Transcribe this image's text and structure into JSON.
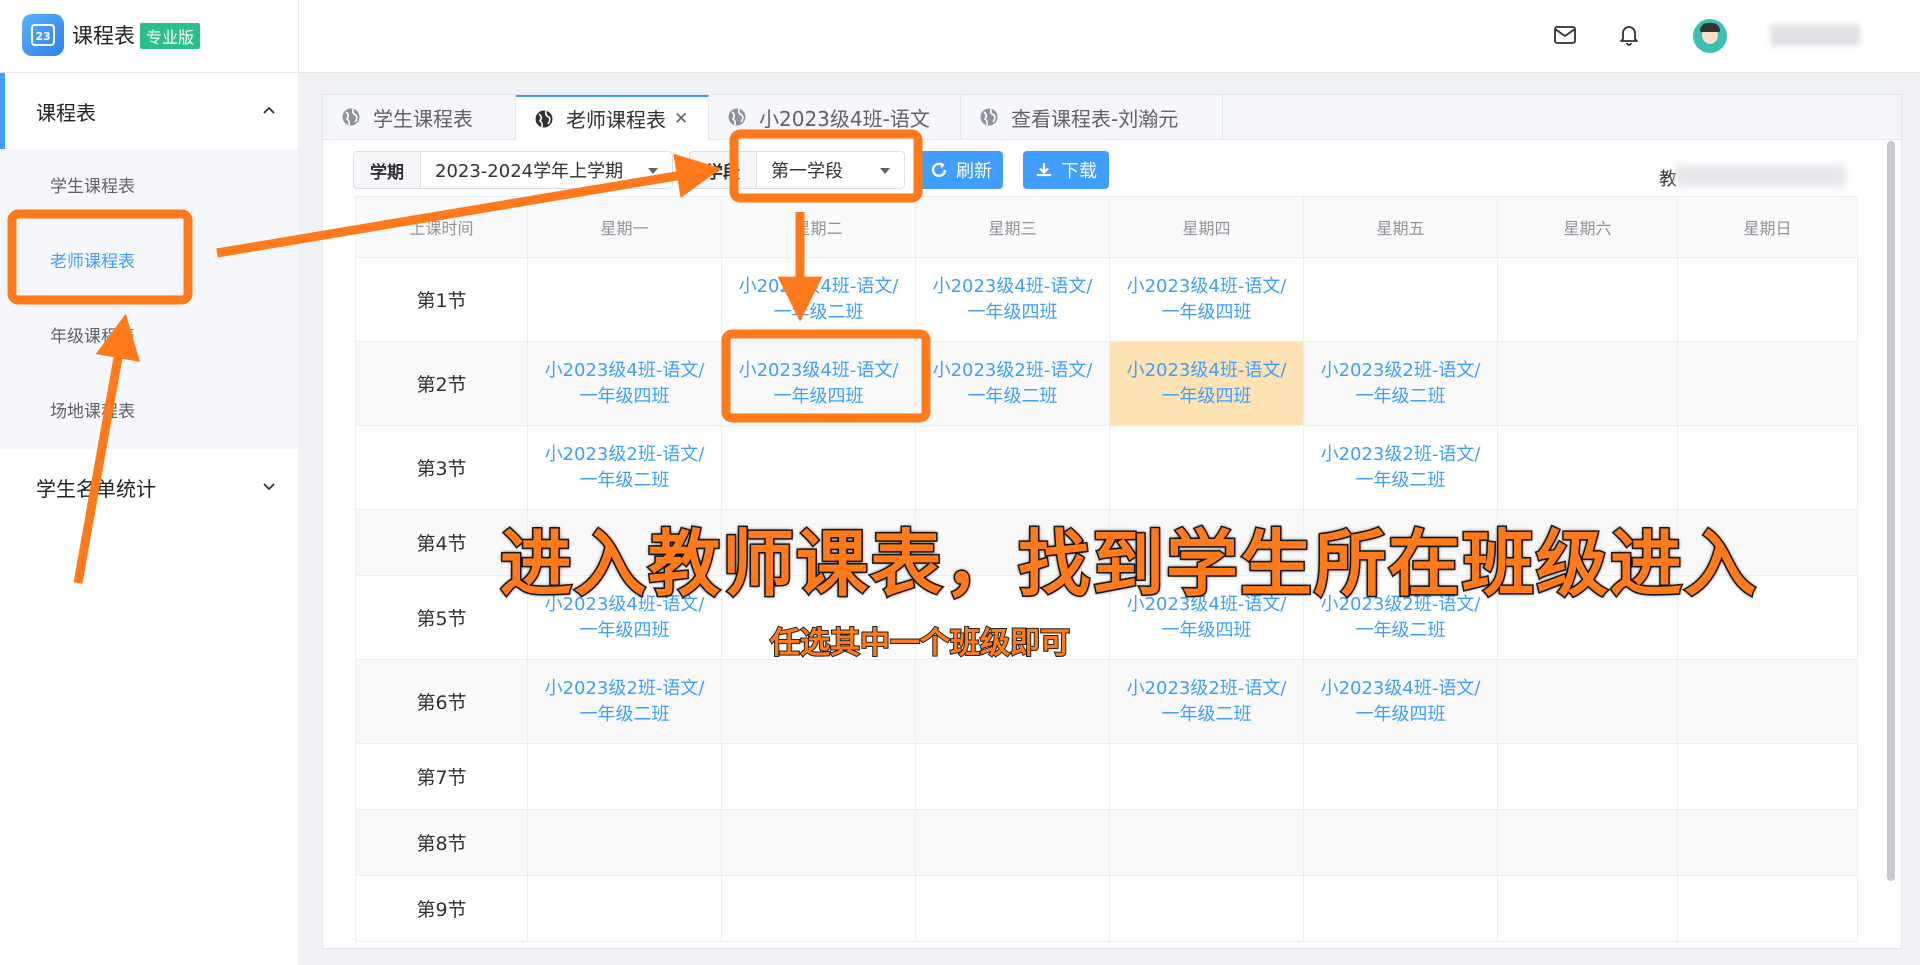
{
  "header": {
    "logo_day": "23",
    "app_name": "课程表",
    "edition_badge": "专业版",
    "icons": [
      "mail-icon",
      "bell-icon"
    ]
  },
  "sidebar": {
    "groups": [
      {
        "label": "课程表",
        "expanded": true,
        "items": [
          "学生课程表",
          "老师课程表",
          "年级课程表",
          "场地课程表"
        ],
        "active_index": 1
      },
      {
        "label": "学生名单统计",
        "expanded": false
      }
    ]
  },
  "tabs": [
    {
      "label": "学生课程表",
      "active": false
    },
    {
      "label": "老师课程表",
      "active": true,
      "closable": true
    },
    {
      "label": "小2023级4班-语文",
      "active": false
    },
    {
      "label": "查看课程表-刘瀚元",
      "active": false
    }
  ],
  "toolbar": {
    "term_label": "学期",
    "term_value": "2023-2024学年上学期",
    "segment_label": "学段",
    "segment_value": "第一学段",
    "refresh_label": "刷新",
    "download_label": "下载",
    "teacher_label": "教"
  },
  "timetable": {
    "columns": [
      "上课时间",
      "星期一",
      "星期二",
      "星期三",
      "星期四",
      "星期五",
      "星期六",
      "星期日"
    ],
    "rows": [
      {
        "period": "第1节",
        "cells": [
          "",
          "小2023级4班-语文/一年级二班",
          "小2023级4班-语文/一年级四班",
          "小2023级4班-语文/一年级四班",
          "",
          "",
          ""
        ]
      },
      {
        "period": "第2节",
        "cells": [
          "小2023级4班-语文/一年级四班",
          "小2023级4班-语文/一年级四班",
          "小2023级2班-语文/一年级二班",
          "小2023级4班-语文/一年级四班",
          "小2023级2班-语文/一年级二班",
          "",
          ""
        ],
        "highlight": [
          3
        ]
      },
      {
        "period": "第3节",
        "cells": [
          "小2023级2班-语文/一年级二班",
          "",
          "",
          "",
          "小2023级2班-语文/一年级二班",
          "",
          ""
        ]
      },
      {
        "period": "第4节",
        "cells": [
          "",
          "",
          "",
          "",
          "",
          "",
          ""
        ]
      },
      {
        "period": "第5节",
        "cells": [
          "小2023级4班-语文/一年级四班",
          "",
          "",
          "小2023级4班-语文/一年级四班",
          "小2023级2班-语文/一年级二班",
          "",
          ""
        ]
      },
      {
        "period": "第6节",
        "cells": [
          "小2023级2班-语文/一年级二班",
          "",
          "",
          "小2023级2班-语文/一年级二班",
          "小2023级4班-语文/一年级四班",
          "",
          ""
        ]
      },
      {
        "period": "第7节",
        "cells": [
          "",
          "",
          "",
          "",
          "",
          "",
          ""
        ]
      },
      {
        "period": "第8节",
        "cells": [
          "",
          "",
          "",
          "",
          "",
          "",
          ""
        ]
      },
      {
        "period": "第9节",
        "cells": [
          "",
          "",
          "",
          "",
          "",
          "",
          ""
        ]
      }
    ]
  },
  "annotation": {
    "main_text": "进入教师课表，找到学生所在班级进入",
    "sub_text": "任选其中一个班级即可",
    "color": "#ff7a1a"
  },
  "colors": {
    "accent": "#409eff",
    "highlight": "#fde2b3",
    "badge": "#2bc08b"
  }
}
